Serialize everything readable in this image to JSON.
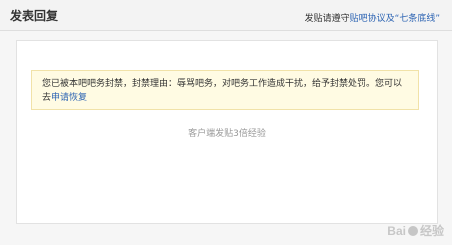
{
  "header": {
    "title": "发表回复",
    "notice_prefix": "发贴请遵守",
    "notice_link": "贴吧协议及“七条底线”"
  },
  "banner": {
    "message": "您已被本吧吧务封禁，封禁理由：辱骂吧务，对吧务工作造成干扰，给予封禁处罚。您可以去",
    "appeal_link": "申请恢复"
  },
  "client_post": "客户端发贴3倍经验",
  "watermark": {
    "left": "Bai",
    "right": "经验"
  },
  "colors": {
    "link": "#2d64b3",
    "banner_bg": "#fffbe3",
    "banner_border": "#f1e2a8"
  }
}
